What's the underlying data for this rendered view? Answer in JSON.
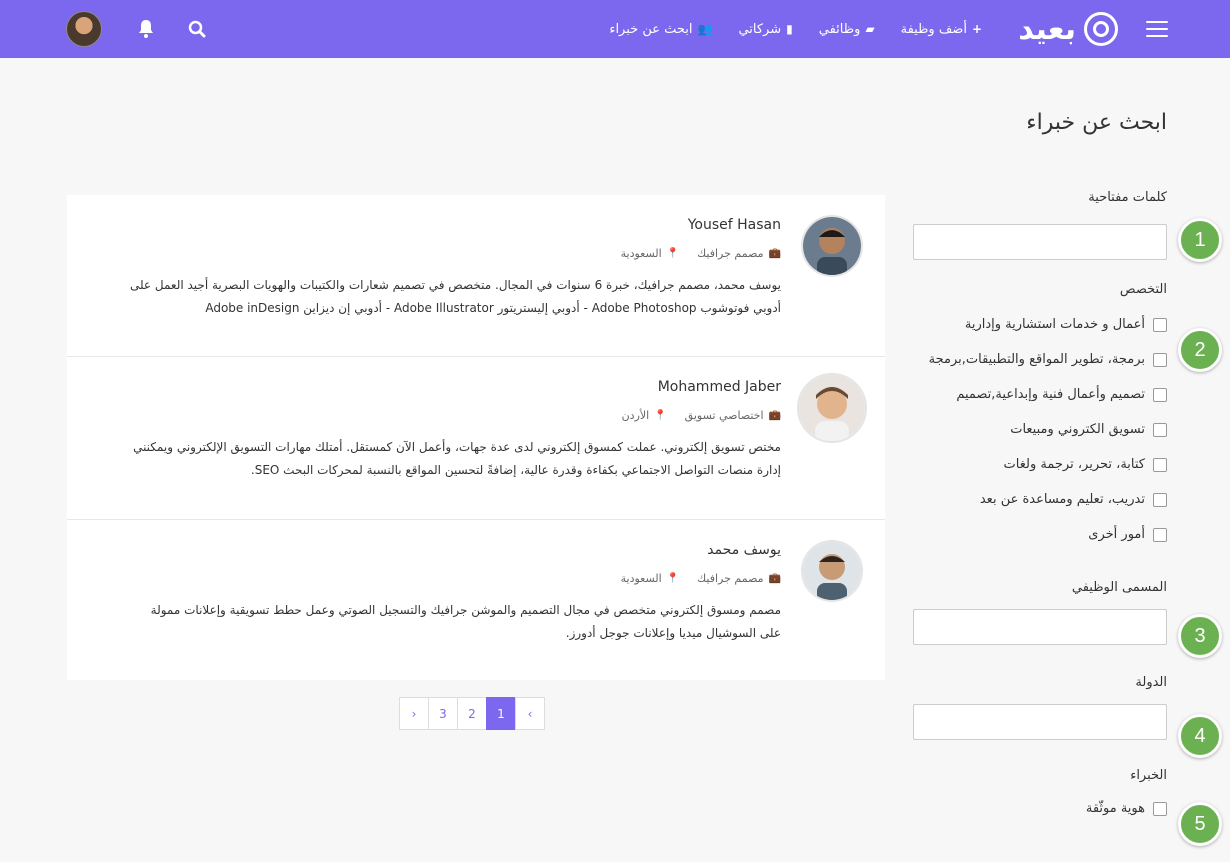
{
  "nav": {
    "logo_text": "بعيد",
    "links": [
      {
        "icon": "+",
        "label": "أضف وظيفة"
      },
      {
        "icon": "▰",
        "label": "وظائفي"
      },
      {
        "icon": "▮",
        "label": "شركاتي"
      },
      {
        "icon": "👥",
        "label": "ابحث عن خبراء"
      }
    ]
  },
  "page_title": "ابحث عن خبراء",
  "filters": {
    "keywords_label": "كلمات مفتاحية",
    "specialty_label": "التخصص",
    "specialties": [
      "أعمال و خدمات استشارية وإدارية",
      "برمجة، تطوير المواقع والتطبيقات,برمجة",
      "تصميم وأعمال فنية وإبداعية,تصميم",
      "تسويق الكتروني ومبيعات",
      "كتابة، تحرير، ترجمة ولغات",
      "تدريب، تعليم ومساعدة عن بعد",
      "أمور أخرى"
    ],
    "job_title_label": "المسمى الوظيفي",
    "country_label": "الدولة",
    "experts_label": "الخبراء",
    "verified_label": "هوية موثّقة"
  },
  "steps": [
    "1",
    "2",
    "3",
    "4",
    "5"
  ],
  "experts": [
    {
      "name": "Yousef Hasan",
      "role": "مصمم جرافيك",
      "country": "السعودية",
      "desc": "يوسف محمد، مصمم جرافيك، خبرة 6 سنوات في المجال. متخصص في تصميم شعارات والكتيبات والهويات البصرية أجيد العمل على أدوبي فوتوشوب Adobe Photoshop - أدوبي إليستريتور Adobe Illustrator - أدوبي إن ديزاين Adobe inDesign"
    },
    {
      "name": "Mohammed Jaber",
      "role": "اختصاصي تسويق",
      "country": "الأردن",
      "desc": "مختص تسويق إلكتروني. عملت كمسوق إلكتروني لدى عدة جهات، وأعمل الآن كمستقل. أمتلك مهارات التسويق الإلكتروني ويمكنني إدارة منصات التواصل الاجتماعي بكفاءة وقدرة عالية، إضافةً لتحسين المواقع بالنسبة لمحركات البحث SEO."
    },
    {
      "name": "يوسف محمد",
      "role": "مصمم جرافيك",
      "country": "السعودية",
      "desc": "مصمم ومسوق إلكتروني متخصص في مجال التصميم والموشن جرافيك والتسجيل الصوتي وعمل حطط تسويقية وإعلانات ممولة على السوشيال ميديا وإعلانات جوجل أدورز."
    }
  ],
  "pagination": [
    "‹",
    "1",
    "2",
    "3",
    "›"
  ],
  "colors": {
    "accent": "#7b68ee",
    "step": "#6bb152"
  }
}
